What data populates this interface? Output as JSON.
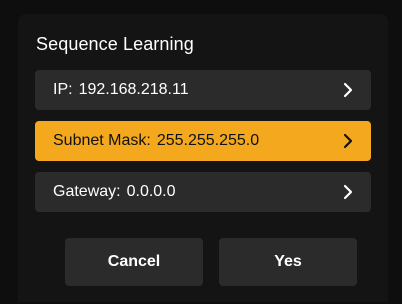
{
  "dialog": {
    "title": "Sequence Learning",
    "rows": [
      {
        "label": "IP:",
        "value": "192.168.218.11",
        "icon": "chevron-right-icon",
        "selected": false
      },
      {
        "label": "Subnet Mask:",
        "value": "255.255.255.0",
        "icon": "chevron-right-icon",
        "selected": true
      },
      {
        "label": "Gateway:",
        "value": "0.0.0.0",
        "icon": "chevron-right-icon",
        "selected": false
      }
    ],
    "buttons": {
      "cancel": "Cancel",
      "yes": "Yes"
    }
  },
  "colors": {
    "background": "#0e0e0e",
    "dialog": "#141414",
    "row": "#2b2b2b",
    "accent": "#f4a81d",
    "text": "#ffffff"
  }
}
